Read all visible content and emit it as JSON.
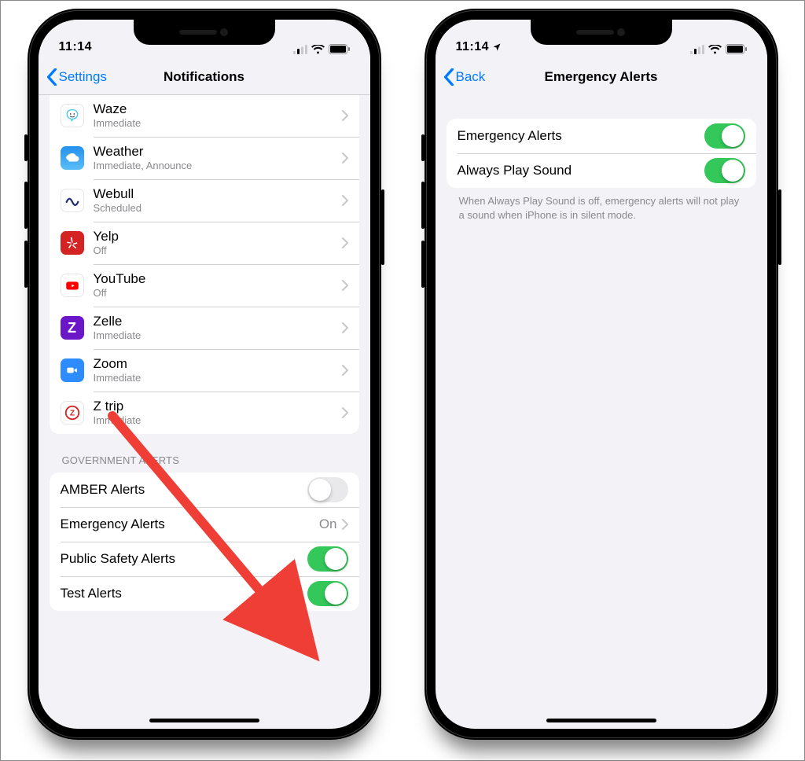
{
  "left": {
    "status": {
      "time": "11:14"
    },
    "nav": {
      "back_label": "Settings",
      "title": "Notifications"
    },
    "apps": [
      {
        "name": "Waze",
        "detail": "Immediate"
      },
      {
        "name": "Weather",
        "detail": "Immediate, Announce"
      },
      {
        "name": "Webull",
        "detail": "Scheduled"
      },
      {
        "name": "Yelp",
        "detail": "Off"
      },
      {
        "name": "YouTube",
        "detail": "Off"
      },
      {
        "name": "Zelle",
        "detail": "Immediate"
      },
      {
        "name": "Zoom",
        "detail": "Immediate"
      },
      {
        "name": "Z trip",
        "detail": "Immediate"
      }
    ],
    "gov_header": "Government Alerts",
    "gov": {
      "amber_label": "AMBER Alerts",
      "amber_on": false,
      "emergency_label": "Emergency Alerts",
      "emergency_value": "On",
      "public_label": "Public Safety Alerts",
      "public_on": true,
      "test_label": "Test Alerts",
      "test_on": true
    }
  },
  "right": {
    "status": {
      "time": "11:14"
    },
    "nav": {
      "back_label": "Back",
      "title": "Emergency Alerts"
    },
    "toggles": {
      "ea_label": "Emergency Alerts",
      "ea_on": true,
      "aps_label": "Always Play Sound",
      "aps_on": true
    },
    "footer_text": "When Always Play Sound is off, emergency alerts will not play a sound when iPhone is in silent mode."
  }
}
